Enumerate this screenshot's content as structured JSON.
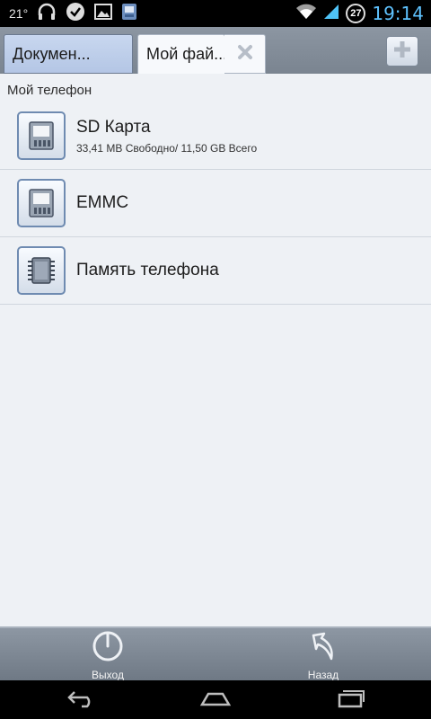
{
  "status_bar": {
    "temperature": "21°",
    "notifications": [
      "headphones-icon",
      "check-circle-icon",
      "image-icon",
      "sd-card-icon"
    ],
    "battery_level": "27",
    "time": "19:14",
    "time_color": "#5fc3ff"
  },
  "tabs": {
    "items": [
      {
        "label": "Докумен..."
      },
      {
        "label": "Мой фай..."
      }
    ]
  },
  "section": {
    "title": "Мой телефон"
  },
  "storage": {
    "items": [
      {
        "title": "SD Карта",
        "subtitle": "33,41 MB Свободно/ 11,50 GB Всего",
        "icon": "sd-card-icon"
      },
      {
        "title": "EMMC",
        "subtitle": "",
        "icon": "sd-card-icon"
      },
      {
        "title": "Память телефона",
        "subtitle": "",
        "icon": "memory-chip-icon"
      }
    ]
  },
  "toolbar": {
    "exit_label": "Выход",
    "back_label": "Назад"
  },
  "colors": {
    "tab_active": "#f7f9fc",
    "tab_inactive": "#b4c6e5",
    "toolbar": "#7a8490",
    "icon_border": "#6f8bb1"
  }
}
